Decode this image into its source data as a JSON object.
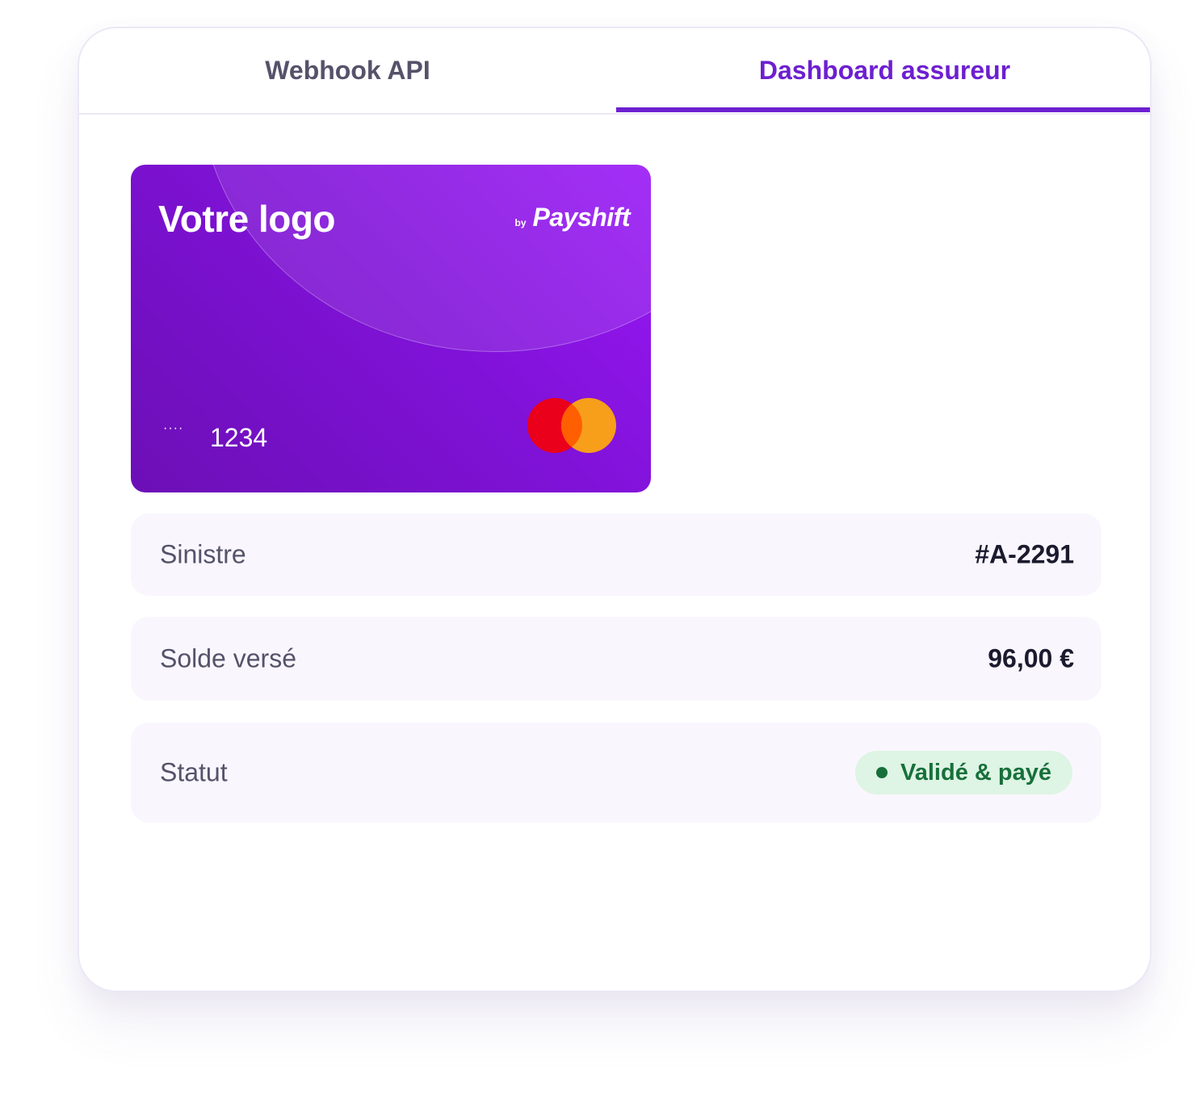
{
  "tabs": {
    "webhook_label": "Webhook API",
    "dashboard_label": "Dashboard assureur",
    "active": "Dashboard assureur"
  },
  "card": {
    "logo_text": "Votre logo",
    "brand_by": "by",
    "brand_name": "Payshift",
    "masked_dots": "····",
    "last_digits": "1234",
    "network_icon": "mastercard-logo",
    "colors": {
      "gradient_start": "#9a18f6",
      "gradient_end": "#6c0fb6"
    }
  },
  "details": {
    "claim_label": "Sinistre",
    "claim_value": "#A-2291",
    "balance_label": "Solde versé",
    "balance_value": "96,00 €",
    "status_label": "Statut",
    "status_value": "Validé & payé"
  },
  "colors": {
    "accent": "#6d20d0",
    "status_green": "#17703a",
    "status_bg": "#def4e4"
  }
}
